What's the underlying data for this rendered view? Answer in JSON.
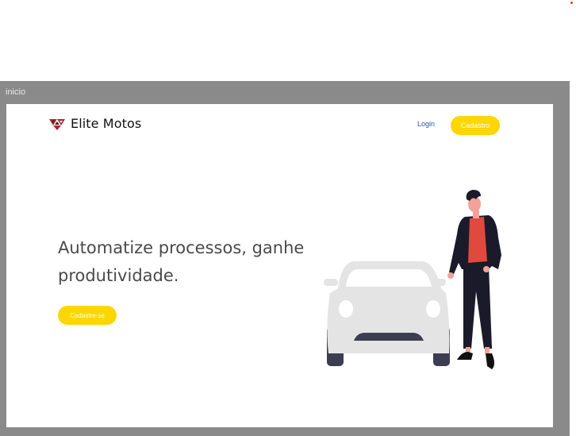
{
  "frame": {
    "label": "inicio"
  },
  "header": {
    "brand": "Elite Motos",
    "login_label": "Login",
    "signup_label": "Cadastro"
  },
  "hero": {
    "title": "Automatize processos, ganhe produtividade.",
    "cta_label": "Cadastre-se"
  },
  "colors": {
    "accent": "#ffd600",
    "link": "#2b56a8",
    "frame_gray": "#8a8a8a",
    "illustration_red": "#e0493e",
    "car_gray": "#e4e4e4"
  },
  "icons": {
    "logo": "triangle-logo-icon",
    "illustration": "man-with-car-illustration"
  }
}
